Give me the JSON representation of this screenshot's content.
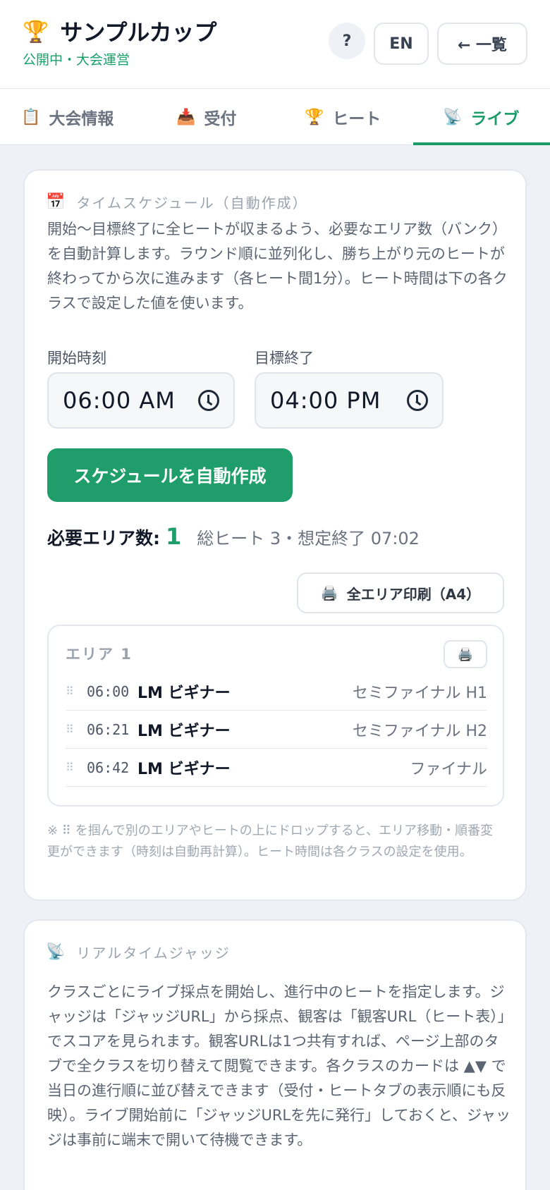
{
  "header": {
    "trophy_icon": "🏆",
    "title": "サンプルカップ",
    "status": "公開中・大会運営",
    "help_label": "?",
    "lang_label": "EN",
    "back_label": "← 一覧"
  },
  "tabs": [
    {
      "icon": "📋",
      "label": "大会情報"
    },
    {
      "icon": "📥",
      "label": "受付"
    },
    {
      "icon": "🏆",
      "label": "ヒート"
    },
    {
      "icon": "📡",
      "label": "ライブ"
    }
  ],
  "schedule": {
    "icon": "📅",
    "heading": "タイムスケジュール（自動作成）",
    "description": "開始〜目標終了に全ヒートが収まるよう、必要なエリア数（バンク）を自動計算します。ラウンド順に並列化し、勝ち上がり元のヒートが終わってから次に進みます（各ヒート間1分）。ヒート時間は下の各クラスで設定した値を使います。",
    "start_label": "開始時刻",
    "start_value": "06:00 AM",
    "end_label": "目標終了",
    "end_value": "04:00 PM",
    "auto_button": "スケジュールを自動作成",
    "required_label": "必要エリア数:",
    "required_count": "1",
    "summary_meta": "総ヒート 3・想定終了 07:02",
    "print_icon": "🖨️",
    "print_all_label": "全エリア印刷（A4）",
    "area": {
      "title": "エリア 1",
      "heats": [
        {
          "time": "06:00",
          "class": "LM ビギナー",
          "round": "セミファイナル H1"
        },
        {
          "time": "06:21",
          "class": "LM ビギナー",
          "round": "セミファイナル H2"
        },
        {
          "time": "06:42",
          "class": "LM ビギナー",
          "round": "ファイナル"
        }
      ]
    },
    "note": "※ ⠿ を掴んで別のエリアやヒートの上にドロップすると、エリア移動・順番変更ができます（時刻は自動再計算）。ヒート時間は各クラスの設定を使用。"
  },
  "live": {
    "icon": "📡",
    "heading": "リアルタイムジャッジ",
    "description": "クラスごとにライブ採点を開始し、進行中のヒートを指定します。ジャッジは「ジャッジURL」から採点、観客は「観客URL（ヒート表）」でスコアを見られます。観客URLは1つ共有すれば、ページ上部のタブで全クラスを切り替えて閲覧できます。各クラスのカードは ▲▼ で当日の進行順に並び替えできます（受付・ヒートタブの表示順にも反映）。ライブ開始前に「ジャッジURLを先に発行」しておくと、ジャッジは事前に端末で開いて待機できます。"
  }
}
